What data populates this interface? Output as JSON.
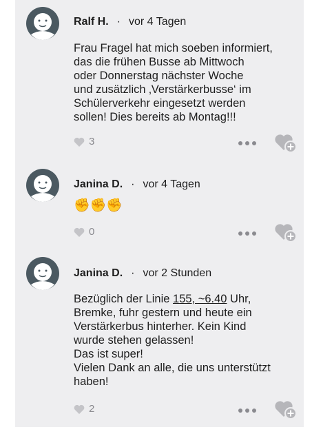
{
  "comments": [
    {
      "author": "Ralf H.",
      "separator": "·",
      "time": "vor 4 Tagen",
      "text": "Frau Fragel hat mich soeben informiert,\ndas die frühen Busse ab Mittwoch\noder Donnerstag nächster Woche\nund zusätzlich ‚Verstärkerbusse‘ im\nSchülerverkehr eingesetzt werden\nsollen! Dies bereits ab Montag!!!",
      "likes": "3"
    },
    {
      "author": "Janina D.",
      "separator": "·",
      "time": "vor 4 Tagen",
      "text": "✊✊✊",
      "likes": "0"
    },
    {
      "author": "Janina D.",
      "separator": "·",
      "time": "vor 2 Stunden",
      "text_prefix": "Bezüglich der Linie ",
      "text_link": "155, ~6.40",
      "text_suffix": " Uhr,\nBremke, fuhr gestern und heute ein\nVerstärkerbus hinterher. Kein Kind\nwurde stehen gelassen!\nDas ist super!\nVielen Dank an alle, die uns unterstützt\nhaben!",
      "likes": "2"
    }
  ],
  "icons": {
    "avatar": "avatar-icon",
    "like": "heart-icon",
    "more": "more-dots-icon",
    "react": "heart-plus-icon"
  },
  "colors": {
    "panel": "#eeeef0",
    "avatar_dark": "#4b5961",
    "icon_gray": "#b6b6ba",
    "emoji": "#f2b01d"
  }
}
